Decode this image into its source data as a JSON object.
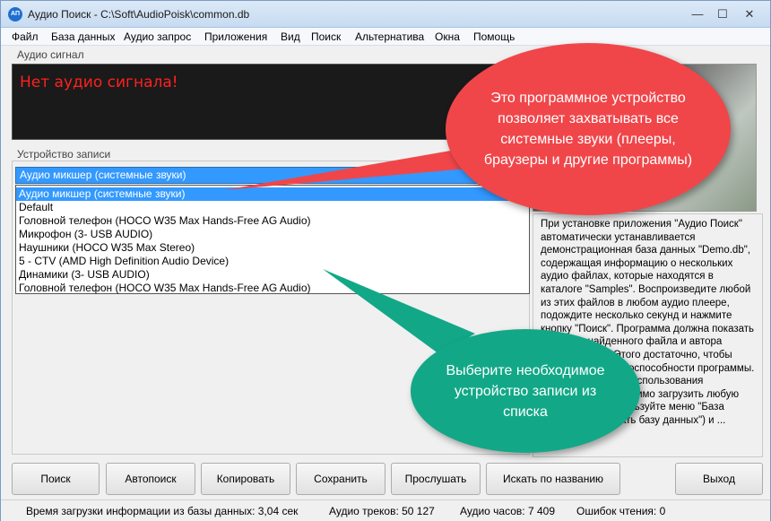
{
  "window": {
    "title": "Аудио Поиск - C:\\Soft\\AudioPoisk\\common.db",
    "icon_text": "АП",
    "minimize": "—",
    "maximize": "☐",
    "close": "✕"
  },
  "menu": [
    "Файл",
    "База данных",
    "Аудио запрос",
    "Приложения",
    "Вид",
    "Поиск",
    "Альтернатива",
    "Окна",
    "Помощь"
  ],
  "audio_signal": {
    "label": "Аудио сигнал",
    "status": "Нет аудио сигнала!"
  },
  "device": {
    "label": "Устройство записи",
    "selected": "Аудио микшер (системные звуки)",
    "options": [
      "Аудио микшер (системные звуки)",
      "Default",
      "Головной телефон (HOCO W35 Max Hands-Free AG Audio)",
      "Микрофон (3- USB AUDIO)",
      "Наушники (HOCO W35 Max Stereo)",
      "5 - CTV (AMD High Definition Audio Device)",
      "Динамики (3- USB AUDIO)",
      "Головной телефон (HOCO W35 Max Hands-Free AG Audio)"
    ]
  },
  "info_text": "При установке приложения \"Аудио Поиск\" автоматически устанавливается демонстрационная база данных \"Demo.db\", содержащая информацию о нескольких аудио файлах, которые находятся в каталоге \"Samples\". Воспроизведите любой из этих файлов в любом аудио плеере, подождите несколько секунд и нажмите кнопку \"Поиск\". Программа должна показать название найденного файла и автора произведения. Этого достаточно, чтобы убедиться в работоспособности программы. Для полноценного использования программы необходимо загрузить любую базу данных (используйте меню \"База данных\" - \"Закачать базу данных\") и ...",
  "buttons": [
    "Поиск",
    "Автопоиск",
    "Копировать",
    "Сохранить",
    "Прослушать",
    "Искать по названию",
    "Выход"
  ],
  "status": {
    "load_time": "Время загрузки информации из базы данных: 3,04 сек",
    "tracks": "Аудио треков: 50 127",
    "hours": "Аудио часов: 7 409",
    "errors": "Ошибок чтения: 0"
  },
  "callouts": {
    "red": "Это программное устройство позволяет захватывать все системные звуки (плееры, браузеры и другие программы)",
    "green": "Выберите необходимое устройство записи из списка"
  },
  "colors": {
    "callout_red": "#f0464a",
    "callout_green": "#12a887",
    "selection": "#3399ff",
    "no_signal_text": "#ff2020"
  }
}
